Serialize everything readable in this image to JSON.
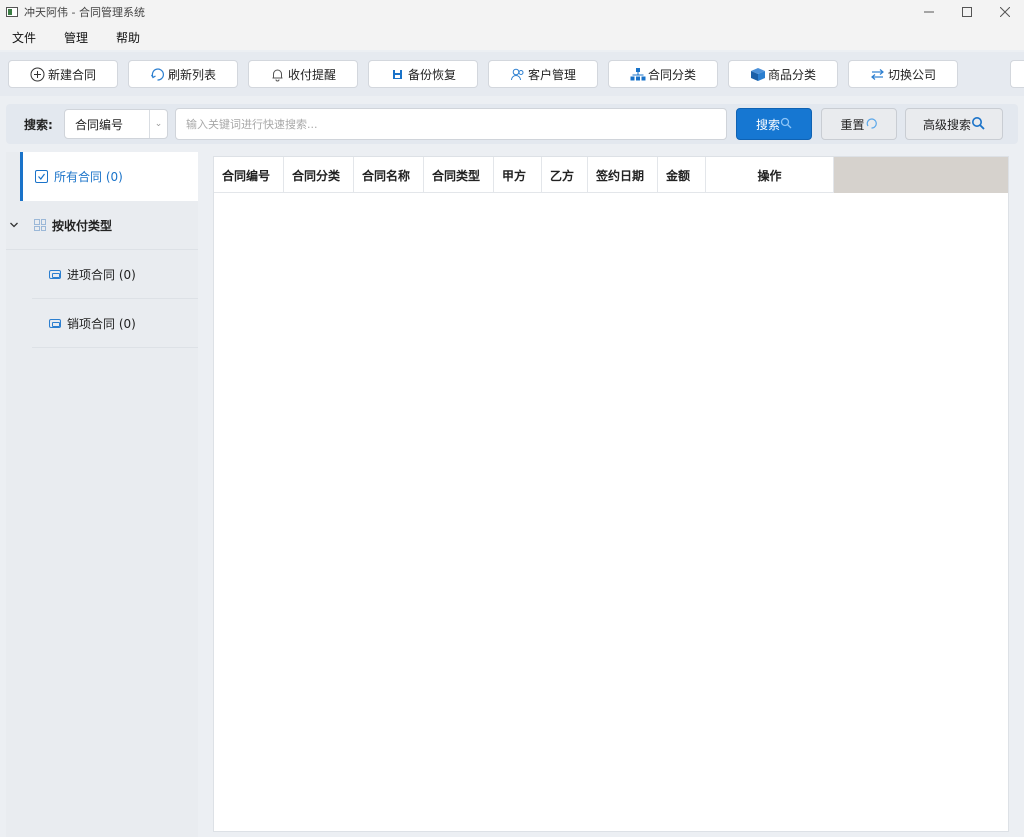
{
  "window": {
    "title": "冲天阿伟 - 合同管理系统",
    "minimize": "—",
    "maximize": "☐",
    "close": "✕"
  },
  "menu": [
    "文件",
    "管理",
    "帮助"
  ],
  "toolbar": [
    {
      "label": "新建合同",
      "icon": "plus-circle-icon"
    },
    {
      "label": "刷新列表",
      "icon": "refresh-icon"
    },
    {
      "label": "收付提醒",
      "icon": "bell-icon"
    },
    {
      "label": "备份恢复",
      "icon": "save-icon"
    },
    {
      "label": "客户管理",
      "icon": "users-icon"
    },
    {
      "label": "合同分类",
      "icon": "hierarchy-icon"
    },
    {
      "label": "商品分类",
      "icon": "box-icon"
    },
    {
      "label": "切换公司",
      "icon": "swap-icon"
    }
  ],
  "search": {
    "label": "搜索:",
    "field_select": "合同编号",
    "placeholder": "输入关键词进行快速搜索...",
    "search_button": "搜索",
    "reset_button": "重置",
    "advanced_button": "高级搜索"
  },
  "sidebar": {
    "all": "所有合同 (0)",
    "group": "按收付类型",
    "children": [
      "进项合同 (0)",
      "销项合同 (0)"
    ]
  },
  "table": {
    "columns": [
      "合同编号",
      "合同分类",
      "合同名称",
      "合同类型",
      "甲方",
      "乙方",
      "签约日期",
      "金额",
      "操作"
    ],
    "rows": []
  },
  "colors": {
    "accent": "#1677d2",
    "active_sidebar": "#1a73c9"
  }
}
